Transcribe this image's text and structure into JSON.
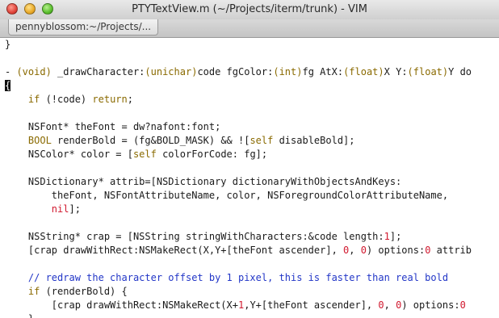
{
  "window": {
    "title": "PTYTextView.m (~/Projects/iterm/trunk) - VIM"
  },
  "tabs": [
    {
      "label": "pennyblossom:~/Projects/..."
    }
  ],
  "editor": {
    "lines": [
      [
        {
          "t": "}",
          "c": ""
        }
      ],
      [
        {
          "t": "",
          "c": ""
        }
      ],
      [
        {
          "t": "- ",
          "c": ""
        },
        {
          "t": "(void)",
          "c": "kw"
        },
        {
          "t": " _drawCharacter:",
          "c": ""
        },
        {
          "t": "(unichar)",
          "c": "kw"
        },
        {
          "t": "code fgColor:",
          "c": ""
        },
        {
          "t": "(int)",
          "c": "kw"
        },
        {
          "t": "fg AtX:",
          "c": ""
        },
        {
          "t": "(float)",
          "c": "kw"
        },
        {
          "t": "X Y:",
          "c": ""
        },
        {
          "t": "(float)",
          "c": "kw"
        },
        {
          "t": "Y do",
          "c": ""
        }
      ],
      [
        {
          "t": "{",
          "c": "cursor"
        }
      ],
      [
        {
          "t": "    ",
          "c": ""
        },
        {
          "t": "if",
          "c": "kw"
        },
        {
          "t": " (!code) ",
          "c": ""
        },
        {
          "t": "return",
          "c": "kw"
        },
        {
          "t": ";",
          "c": ""
        }
      ],
      [
        {
          "t": "",
          "c": ""
        }
      ],
      [
        {
          "t": "    NSFont* theFont = dw?nafont:font;",
          "c": ""
        }
      ],
      [
        {
          "t": "    ",
          "c": ""
        },
        {
          "t": "BOOL",
          "c": "kw"
        },
        {
          "t": " renderBold = (fg&BOLD_MASK) && ![",
          "c": ""
        },
        {
          "t": "self",
          "c": "kw"
        },
        {
          "t": " disableBold];",
          "c": ""
        }
      ],
      [
        {
          "t": "    NSColor* color = [",
          "c": ""
        },
        {
          "t": "self",
          "c": "kw"
        },
        {
          "t": " colorForCode: fg];",
          "c": ""
        }
      ],
      [
        {
          "t": "",
          "c": ""
        }
      ],
      [
        {
          "t": "    NSDictionary* attrib=[NSDictionary dictionaryWithObjectsAndKeys:",
          "c": ""
        }
      ],
      [
        {
          "t": "        theFont, NSFontAttributeName, color, NSForegroundColorAttributeName,",
          "c": ""
        }
      ],
      [
        {
          "t": "        ",
          "c": ""
        },
        {
          "t": "nil",
          "c": "num"
        },
        {
          "t": "];",
          "c": ""
        }
      ],
      [
        {
          "t": "",
          "c": ""
        }
      ],
      [
        {
          "t": "    NSString* crap = [NSString stringWithCharacters:&code length:",
          "c": ""
        },
        {
          "t": "1",
          "c": "num"
        },
        {
          "t": "];",
          "c": ""
        }
      ],
      [
        {
          "t": "    [crap drawWithRect:NSMakeRect(X,Y+[theFont ascender], ",
          "c": ""
        },
        {
          "t": "0",
          "c": "num"
        },
        {
          "t": ", ",
          "c": ""
        },
        {
          "t": "0",
          "c": "num"
        },
        {
          "t": ") options:",
          "c": ""
        },
        {
          "t": "0",
          "c": "num"
        },
        {
          "t": " attrib",
          "c": ""
        }
      ],
      [
        {
          "t": "",
          "c": ""
        }
      ],
      [
        {
          "t": "    // redraw the character offset by 1 pixel, this is faster than real bold",
          "c": "cmt"
        }
      ],
      [
        {
          "t": "    ",
          "c": ""
        },
        {
          "t": "if",
          "c": "kw"
        },
        {
          "t": " (renderBold) {",
          "c": ""
        }
      ],
      [
        {
          "t": "        [crap drawWithRect:NSMakeRect(X+",
          "c": ""
        },
        {
          "t": "1",
          "c": "num"
        },
        {
          "t": ",Y+[theFont ascender], ",
          "c": ""
        },
        {
          "t": "0",
          "c": "num"
        },
        {
          "t": ", ",
          "c": ""
        },
        {
          "t": "0",
          "c": "num"
        },
        {
          "t": ") options:",
          "c": ""
        },
        {
          "t": "0",
          "c": "num"
        }
      ],
      [
        {
          "t": "    }",
          "c": ""
        }
      ]
    ]
  }
}
